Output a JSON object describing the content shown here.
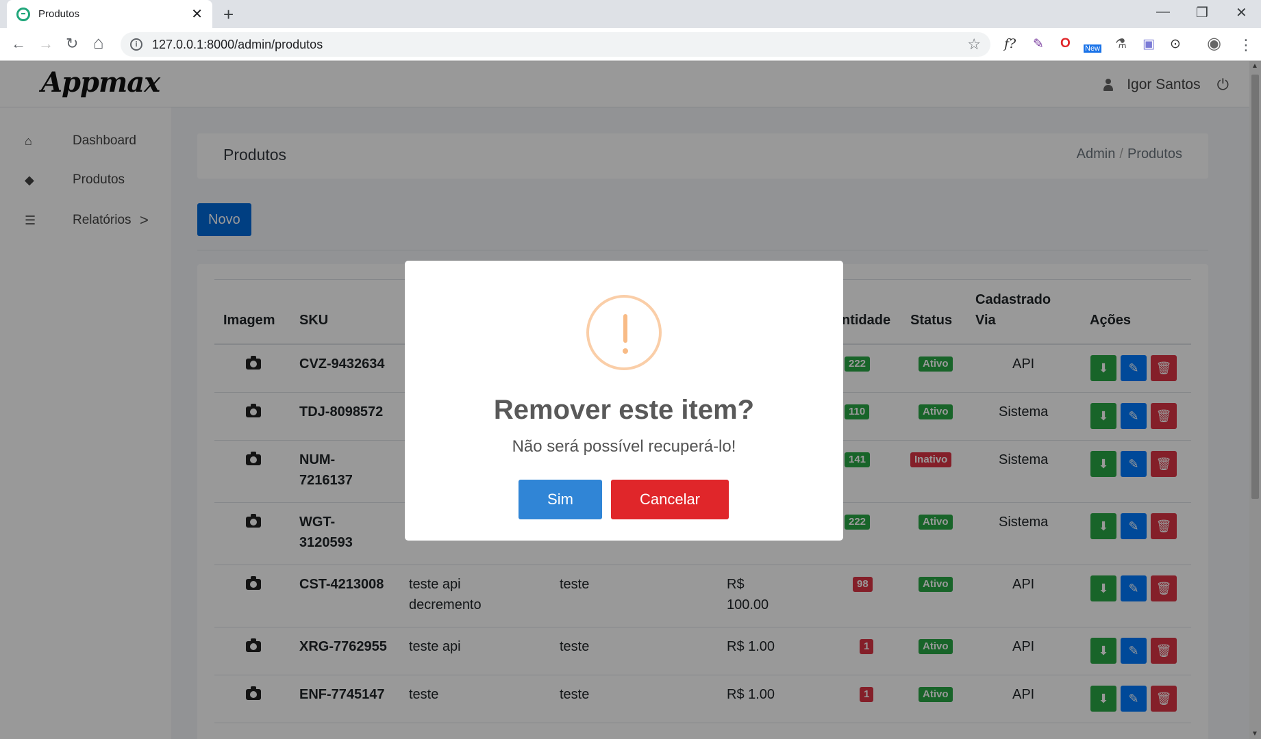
{
  "browser": {
    "tab_title": "Produtos",
    "tab_close": "✕",
    "new_tab": "+",
    "minimize": "—",
    "restore": "❐",
    "close": "✕",
    "back": "←",
    "forward": "→",
    "reload": "↻",
    "home": "⌂",
    "url": "127.0.0.1:8000/admin/produtos",
    "extensions": [
      "f?",
      "✎",
      "O",
      "New",
      "⚗",
      "▣",
      "⊙",
      "◉",
      "⋮"
    ]
  },
  "app": {
    "logo": "Appmax",
    "user_name": "Igor Santos"
  },
  "sidebar": {
    "items": [
      {
        "label": "Dashboard",
        "icon": "home-icon"
      },
      {
        "label": "Produtos",
        "icon": "tags-icon"
      },
      {
        "label": "Relatórios",
        "icon": "list-icon",
        "chevron": ">"
      }
    ]
  },
  "page": {
    "title": "Produtos",
    "breadcrumb": [
      "Admin",
      "Produtos"
    ],
    "breadcrumb_sep": "/",
    "new_button": "Novo"
  },
  "table": {
    "headers": {
      "imagem": "Imagem",
      "sku": "SKU",
      "quantidade": "ntidade",
      "status": "Status",
      "via": "Cadastrado Via",
      "acoes": "Ações"
    },
    "rows": [
      {
        "sku": "CVZ-9432634",
        "name": "",
        "desc": "",
        "price": "",
        "qty": "222",
        "status": "Ativo",
        "via": "API"
      },
      {
        "sku": "TDJ-8098572",
        "name": "",
        "desc": "",
        "price": "",
        "qty": "110",
        "status": "Ativo",
        "via": "Sistema"
      },
      {
        "sku": "NUM-7216137",
        "name": "",
        "desc": "",
        "price": "",
        "qty": "141",
        "status": "Inativo",
        "via": "Sistema"
      },
      {
        "sku": "WGT-3120593",
        "name": "",
        "desc": "",
        "price": "",
        "qty": "222",
        "status": "Ativo",
        "via": "Sistema"
      },
      {
        "sku": "CST-4213008",
        "name": "teste api decremento",
        "desc": "teste",
        "price": "R$ 100.00",
        "qty": "98",
        "status": "Ativo",
        "via": "API"
      },
      {
        "sku": "XRG-7762955",
        "name": "teste api",
        "desc": "teste",
        "price": "R$ 1.00",
        "qty": "1",
        "status": "Ativo",
        "via": "API"
      },
      {
        "sku": "ENF-7745147",
        "name": "teste",
        "desc": "teste",
        "price": "R$ 1.00",
        "qty": "1",
        "status": "Ativo",
        "via": "API"
      }
    ],
    "action_icons": {
      "download": "⬇",
      "edit": "✎",
      "delete": "🗑"
    }
  },
  "modal": {
    "icon": "warning-icon",
    "title": "Remover este item?",
    "text": "Não será possível recuperá-lo!",
    "confirm": "Sim",
    "cancel": "Cancelar"
  },
  "colors": {
    "primary": "#0069d9",
    "success": "#28a745",
    "danger": "#dc3545",
    "modal_confirm": "#3085d6",
    "modal_cancel": "#e0262a",
    "warning_ring": "#facea8"
  }
}
